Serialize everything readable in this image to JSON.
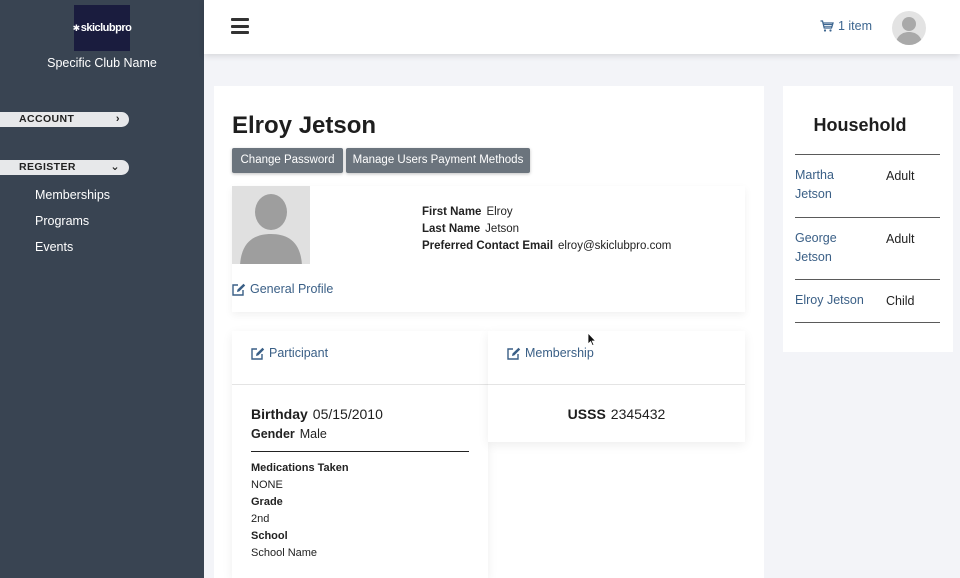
{
  "sidebar": {
    "logo_text": "skiclubpro",
    "club_name": "Specific Club Name",
    "account_label": "ACCOUNT",
    "register_label": "REGISTER",
    "register_items": [
      "Memberships",
      "Programs",
      "Events"
    ]
  },
  "topbar": {
    "cart_label": "1 item"
  },
  "profile": {
    "name": "Elroy Jetson",
    "change_password_label": "Change Password",
    "payment_methods_label": "Manage Users Payment Methods",
    "first_name_label": "First Name",
    "first_name": "Elroy",
    "last_name_label": "Last Name",
    "last_name": "Jetson",
    "email_label": "Preferred Contact Email",
    "email": "elroy@skiclubpro.com",
    "general_profile_label": "General Profile"
  },
  "participant": {
    "heading": "Participant",
    "birthday_label": "Birthday",
    "birthday": "05/15/2010",
    "gender_label": "Gender",
    "gender": "Male",
    "medications_label": "Medications Taken",
    "medications": "NONE",
    "grade_label": "Grade",
    "grade": "2nd",
    "school_label": "School",
    "school": "School Name"
  },
  "membership": {
    "heading": "Membership",
    "org_label": "USSS",
    "number": "2345432"
  },
  "household": {
    "title": "Household",
    "members": [
      {
        "name": "Martha Jetson",
        "role": "Adult"
      },
      {
        "name": "George Jetson",
        "role": "Adult"
      },
      {
        "name": "Elroy Jetson",
        "role": "Child"
      }
    ]
  },
  "colors": {
    "sidebar_bg": "#394452",
    "link": "#3a5f86",
    "button_bg": "#6b747d"
  },
  "icons": [
    "menu-icon",
    "cart-icon",
    "user-avatar-icon",
    "edit-icon",
    "chevron-right-icon",
    "chevron-down-icon"
  ]
}
